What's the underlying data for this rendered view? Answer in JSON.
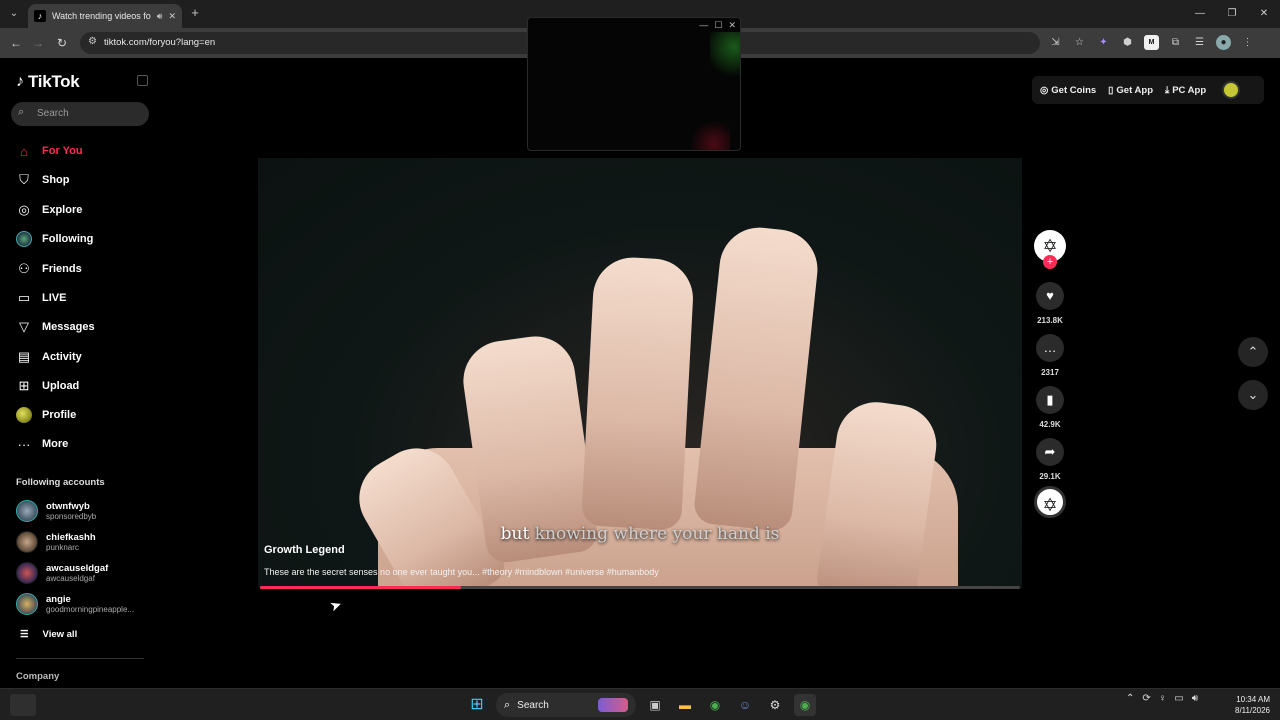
{
  "browser": {
    "tab_title": "Watch trending videos for y",
    "url": "tiktok.com/foryou?lang=en"
  },
  "sidebar": {
    "logo": "TikTok",
    "search_placeholder": "Search",
    "nav": [
      {
        "label": "For You",
        "icon": "home-icon",
        "active": true
      },
      {
        "label": "Shop",
        "icon": "shopping-bag-icon"
      },
      {
        "label": "Explore",
        "icon": "compass-icon"
      },
      {
        "label": "Following",
        "icon": "avatar"
      },
      {
        "label": "Friends",
        "icon": "friends-icon"
      },
      {
        "label": "LIVE",
        "icon": "live-icon"
      },
      {
        "label": "Messages",
        "icon": "paper-plane-icon"
      },
      {
        "label": "Activity",
        "icon": "activity-icon"
      },
      {
        "label": "Upload",
        "icon": "plus-square-icon"
      },
      {
        "label": "Profile",
        "icon": "avatar"
      },
      {
        "label": "More",
        "icon": "more-dots-icon"
      }
    ],
    "following_title": "Following accounts",
    "accounts": [
      {
        "name": "otwnfwyb",
        "handle": "sponsoredbyb"
      },
      {
        "name": "chiefkashh",
        "handle": "punknarc"
      },
      {
        "name": "awcauseldgaf",
        "handle": "awcauseldgaf"
      },
      {
        "name": "angie",
        "handle": "goodmorningpineapple..."
      }
    ],
    "view_all": "View all",
    "company": "Company"
  },
  "top_actions": {
    "coins": "Get Coins",
    "app": "Get App",
    "pc_app": "PC App"
  },
  "video": {
    "subtitle_highlight": "but",
    "subtitle_rest": "knowing where your hand is",
    "author": "Growth Legend",
    "description": "These are the secret senses no one ever taught you... #theory #mindblown #universe #humanbody",
    "progress": 0.265
  },
  "actions": {
    "likes": "213.8K",
    "comments": "2317",
    "saves": "42.9K",
    "shares": "29.1K"
  },
  "taskbar": {
    "search": "Search",
    "time": "10:34 AM",
    "date": "8/11/2026"
  },
  "colors": {
    "accent": "#fe2c55",
    "sidebar_bg": "#000000",
    "chrome_bg": "#3c3c3c"
  }
}
